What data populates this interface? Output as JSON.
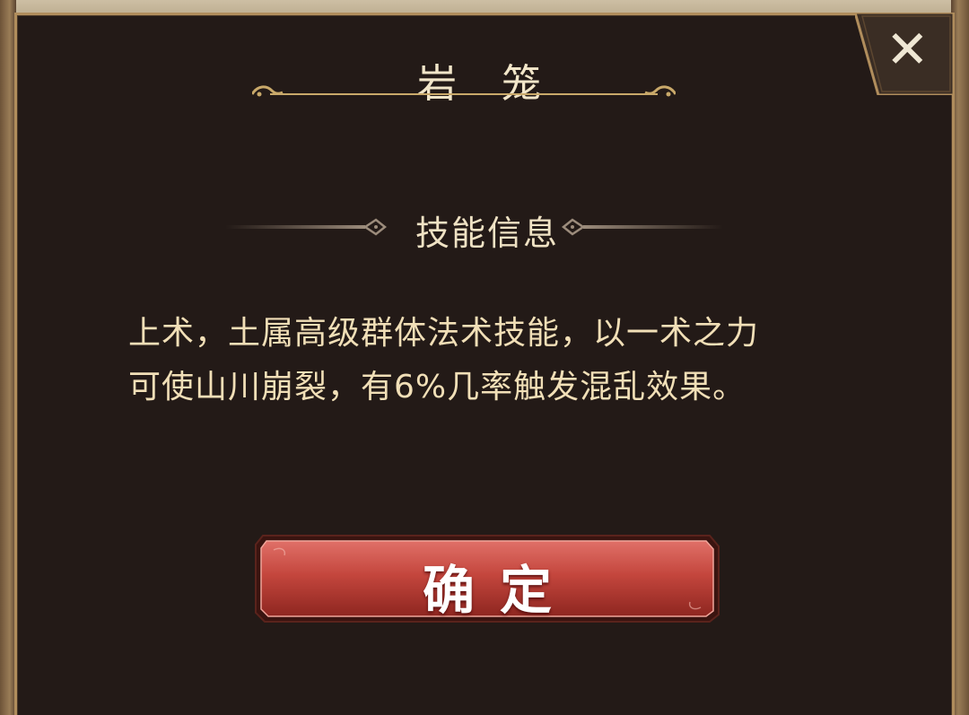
{
  "dialog": {
    "title": "岩 笼",
    "close_icon": "close-x-icon",
    "section_header": "技能信息",
    "description_line1": "上术，土属高级群体法术技能，以一术之力",
    "description_line2": "可使山川崩裂，有6%几率触发混乱效果。",
    "confirm_label": "确定"
  },
  "colors": {
    "panel": "#231a17",
    "border_gold": "#b08d5c",
    "text_cream": "#f1dfb7",
    "button_red": "#c0483f"
  }
}
